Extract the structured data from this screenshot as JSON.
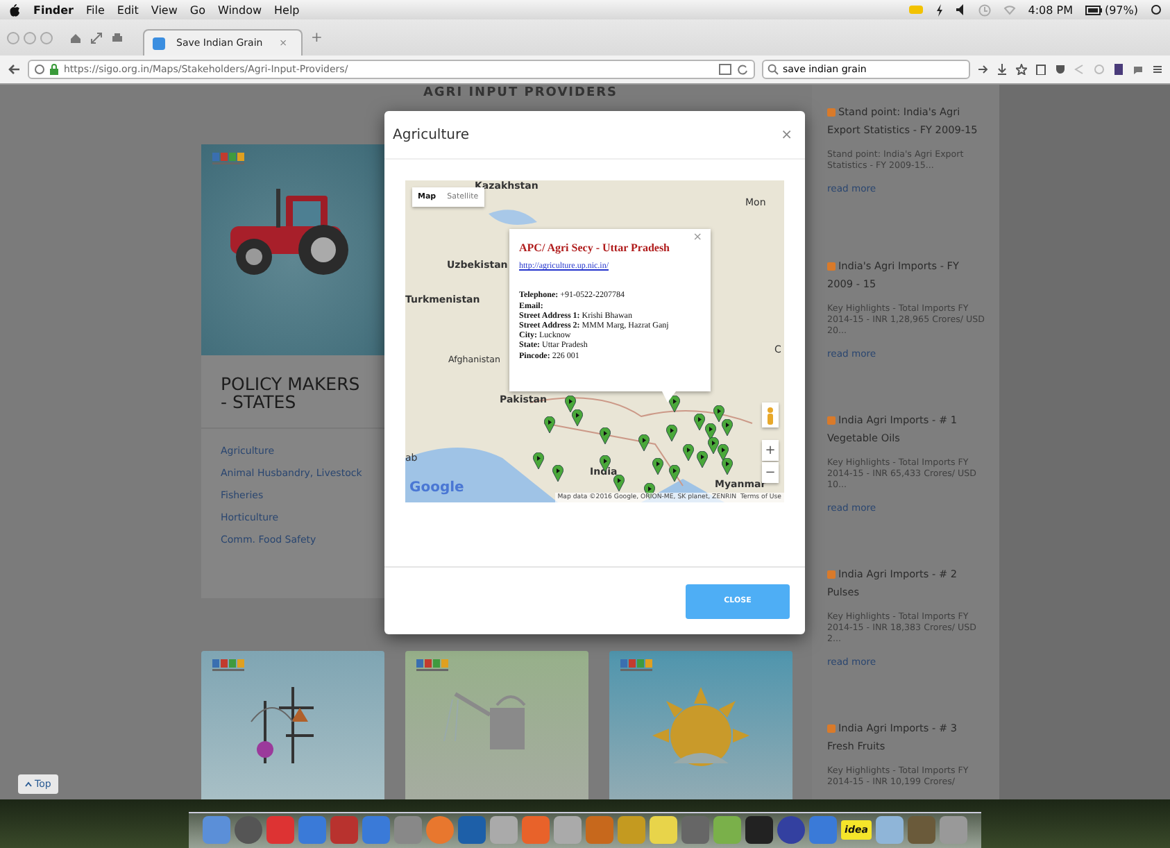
{
  "menubar": {
    "app": "Finder",
    "menus": [
      "File",
      "Edit",
      "View",
      "Go",
      "Window",
      "Help"
    ],
    "time": "4:08 PM",
    "battery": "(97%)"
  },
  "browser": {
    "tab": {
      "title": "Save Indian Grain",
      "close": "×"
    },
    "new_tab": "+",
    "url": "https://sigo.org.in/Maps/Stakeholders/Agri-Input-Providers/",
    "search": {
      "value": "save indian grain"
    }
  },
  "page": {
    "heading": "AGRI INPUT PROVIDERS",
    "card": {
      "title": "POLICY MAKERS - STATES",
      "links": [
        "Agriculture",
        "Animal Husbandry, Livestock",
        "Fisheries",
        "Horticulture",
        "Comm. Food Safety"
      ]
    },
    "sidebar": [
      {
        "title": "Stand point: India's Agri Export Statistics - FY 2009-15",
        "excerpt": "Stand point: India's Agri Export Statistics - FY 2009-15...",
        "link": "read more"
      },
      {
        "title": "India's Agri Imports - FY 2009 - 15",
        "excerpt": "Key Highlights - Total Imports FY 2014-15 - INR 1,28,965 Crores/ USD 20...",
        "link": "read more"
      },
      {
        "title": "India Agri Imports - # 1 Vegetable Oils",
        "excerpt": "Key Highlights - Total Imports FY 2014-15 - INR 65,433 Crores/ USD 10...",
        "link": "read more"
      },
      {
        "title": "India Agri Imports - # 2 Pulses",
        "excerpt": "Key Highlights - Total Imports FY 2014-15 - INR 18,383 Crores/ USD 2...",
        "link": "read more"
      },
      {
        "title": "India Agri Imports - # 3 Fresh Fruits",
        "excerpt": "Key Highlights - Total Imports FY 2014-15 - INR 10,199 Crores/"
      }
    ],
    "top_button": "Top"
  },
  "modal": {
    "title": "Agriculture",
    "close": "×",
    "map": {
      "types": [
        {
          "label": "Map",
          "selected": true
        },
        {
          "label": "Satellite",
          "selected": false
        }
      ],
      "labels": [
        "Kazakhstan",
        "Mon",
        "Uzbekistan",
        "Turkmenistan",
        "Afghanistan",
        "Pakistan",
        "India",
        "Myanmar",
        "C",
        "ab"
      ],
      "info": {
        "title": "APC/ Agri Secy - Uttar Pradesh",
        "close": "×",
        "link": "http://agriculture.up.nic.in/",
        "fields": [
          {
            "label": "Telephone:",
            "value": "+91-0522-2207784"
          },
          {
            "label": "Email:"
          },
          {
            "label": "Street Address 1:",
            "value": "Krishi Bhawan"
          },
          {
            "label": "Street Address 2:",
            "value": "MMM Marg, Hazrat Ganj"
          },
          {
            "label": "City:",
            "value": "Lucknow"
          },
          {
            "label": "State:",
            "value": "Uttar Pradesh"
          },
          {
            "label": "Pincode:",
            "value": "226 001"
          }
        ]
      },
      "logo": "Google",
      "zoom_in": "+",
      "zoom_out": "−",
      "attribution": "Map data ©2016 Google, ORION-ME, SK planet, ZENRIN",
      "terms": "Terms of Use"
    },
    "button": "CLOSE"
  },
  "dock": {
    "badge": "idea"
  }
}
